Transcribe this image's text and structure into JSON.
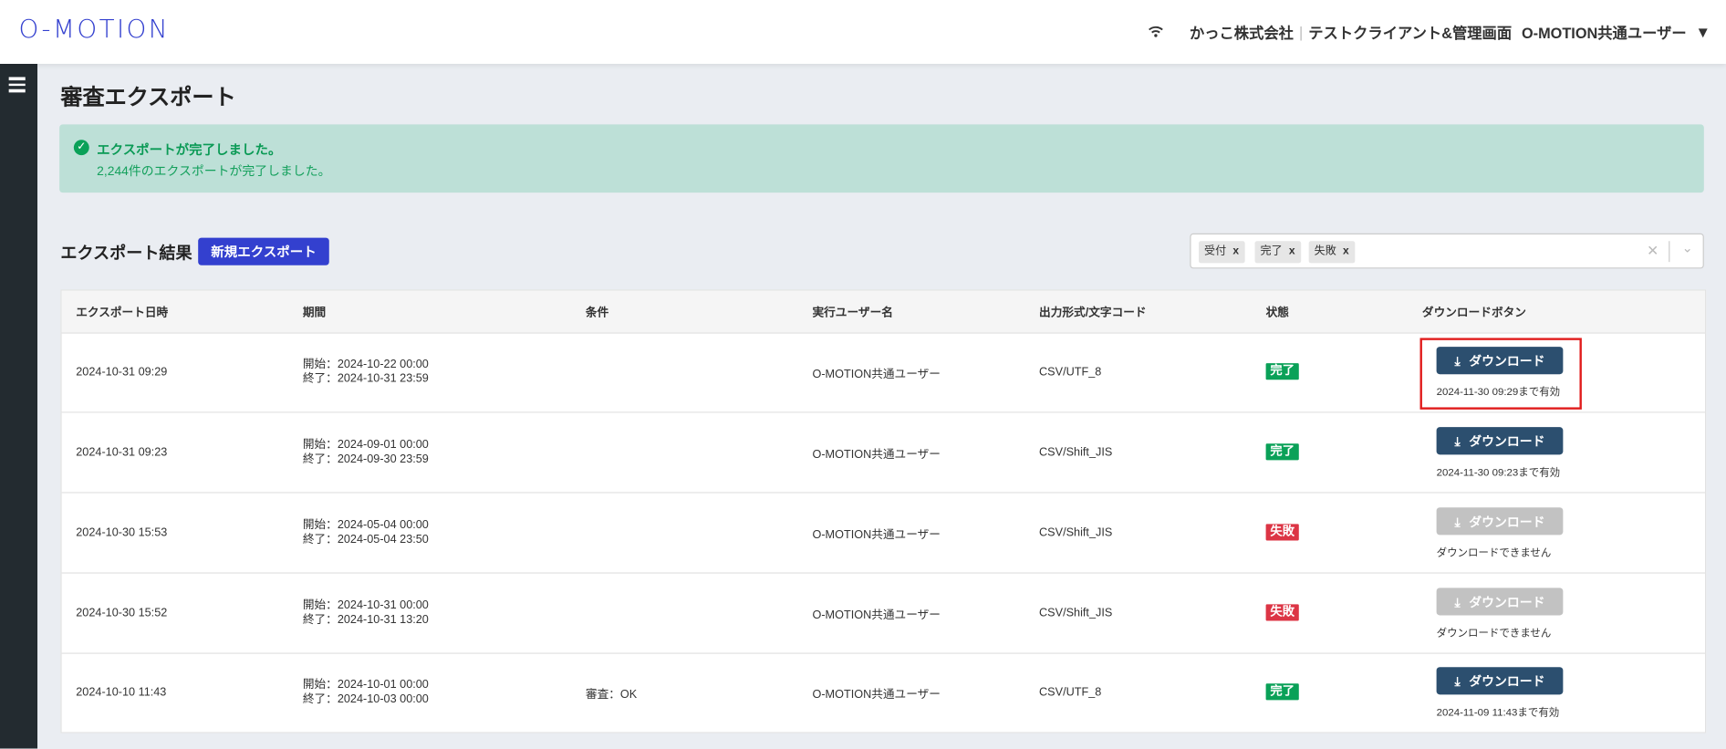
{
  "header": {
    "logo": "O-MOTION",
    "company": "かっこ株式会社",
    "separator": "|",
    "client": "テストクライアント&管理画面",
    "user": "O-MOTION共通ユーザー"
  },
  "page": {
    "title": "審査エクスポート"
  },
  "alert": {
    "title": "エクスポートが完了しました。",
    "message": "2,244件のエクスポートが完了しました。"
  },
  "results": {
    "heading": "エクスポート結果",
    "new_export_label": "新規エクスポート",
    "filter_tags": [
      "受付",
      "完了",
      "失敗"
    ]
  },
  "table": {
    "columns": [
      "エクスポート日時",
      "期間",
      "条件",
      "実行ユーザー名",
      "出力形式/文字コード",
      "状態",
      "ダウンロードボタン"
    ],
    "download_label": "ダウンロード",
    "rows": [
      {
        "date": "2024-10-31 09:29",
        "start": "開始：2024-10-22 00:00",
        "end": "終了：2024-10-31 23:59",
        "condition": "",
        "user": "O-MOTION共通ユーザー",
        "format": "CSV/UTF_8",
        "status": "完了",
        "note": "2024-11-30 09:29まで有効"
      },
      {
        "date": "2024-10-31 09:23",
        "start": "開始：2024-09-01 00:00",
        "end": "終了：2024-09-30 23:59",
        "condition": "",
        "user": "O-MOTION共通ユーザー",
        "format": "CSV/Shift_JIS",
        "status": "完了",
        "note": "2024-11-30 09:23まで有効"
      },
      {
        "date": "2024-10-30 15:53",
        "start": "開始：2024-05-04 00:00",
        "end": "終了：2024-05-04 23:50",
        "condition": "",
        "user": "O-MOTION共通ユーザー",
        "format": "CSV/Shift_JIS",
        "status": "失敗",
        "note": "ダウンロードできません"
      },
      {
        "date": "2024-10-30 15:52",
        "start": "開始：2024-10-31 00:00",
        "end": "終了：2024-10-31 13:20",
        "condition": "",
        "user": "O-MOTION共通ユーザー",
        "format": "CSV/Shift_JIS",
        "status": "失敗",
        "note": "ダウンロードできません"
      },
      {
        "date": "2024-10-10 11:43",
        "start": "開始：2024-10-01 00:00",
        "end": "終了：2024-10-03 00:00",
        "condition": "審査：OK",
        "user": "O-MOTION共通ユーザー",
        "format": "CSV/UTF_8",
        "status": "完了",
        "note": "2024-11-09 11:43まで有効"
      }
    ]
  },
  "colors": {
    "brand": "#3340cf",
    "success": "#0aa158",
    "danger": "#dc3545",
    "download": "#2c4f6f",
    "disabled": "#c2c2c2",
    "highlight": "#e11d1d"
  }
}
